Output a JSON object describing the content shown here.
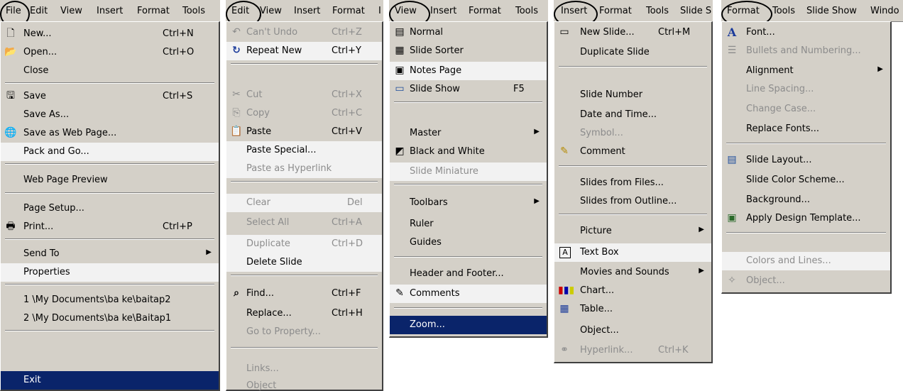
{
  "file_panel": {
    "menubar": [
      "File",
      "Edit",
      "View",
      "Insert",
      "Format",
      "Tools"
    ],
    "rows": [
      {
        "icon": "new-document-icon",
        "label": "New...",
        "shortcut": "Ctrl+N"
      },
      {
        "icon": "open-folder-icon",
        "label": "Open...",
        "shortcut": "Ctrl+O"
      },
      {
        "label": "Close"
      },
      {
        "icon": "save-disk-icon",
        "label": "Save",
        "shortcut": "Ctrl+S"
      },
      {
        "label": "Save As..."
      },
      {
        "icon": "save-web-page-icon",
        "label": "Save as Web Page..."
      },
      {
        "label": "Pack and Go..."
      },
      {
        "label": "Web Page Preview"
      },
      {
        "label": "Page Setup..."
      },
      {
        "icon": "printer-icon",
        "label": "Print...",
        "shortcut": "Ctrl+P"
      },
      {
        "label": "Send To",
        "submenu": true
      },
      {
        "label": "Properties"
      },
      {
        "label": "1 \\My Documents\\ba ke\\baitap2"
      },
      {
        "label": "2 \\My Documents\\ba ke\\Baitap1"
      },
      {
        "label": "Exit"
      }
    ]
  },
  "edit_panel": {
    "menubar": [
      "Edit",
      "View",
      "Insert",
      "Format",
      "I"
    ],
    "rows": [
      {
        "icon": "undo-icon",
        "label": "Can't Undo",
        "shortcut": "Ctrl+Z",
        "disabled": true
      },
      {
        "icon": "repeat-icon",
        "label": "Repeat New",
        "shortcut": "Ctrl+Y"
      },
      {
        "icon": "cut-scissors-icon",
        "label": "Cut",
        "shortcut": "Ctrl+X",
        "disabled": true
      },
      {
        "icon": "copy-icon",
        "label": "Copy",
        "shortcut": "Ctrl+C",
        "disabled": true
      },
      {
        "icon": "paste-clipboard-icon",
        "label": "Paste",
        "shortcut": "Ctrl+V"
      },
      {
        "label": "Paste Special..."
      },
      {
        "label": "Paste as Hyperlink",
        "disabled": true
      },
      {
        "label": "Clear",
        "shortcut": "Del",
        "disabled": true
      },
      {
        "label": "Select All",
        "shortcut": "Ctrl+A",
        "disabled": true
      },
      {
        "label": "Duplicate",
        "shortcut": "Ctrl+D",
        "disabled": true
      },
      {
        "label": "Delete Slide"
      },
      {
        "icon": "binoculars-icon",
        "label": "Find...",
        "shortcut": "Ctrl+F"
      },
      {
        "label": "Replace...",
        "shortcut": "Ctrl+H"
      },
      {
        "label": "Go to Property...",
        "disabled": true
      },
      {
        "label": "Links...",
        "disabled": true
      },
      {
        "label": "Object",
        "disabled": true
      }
    ]
  },
  "view_panel": {
    "menubar": [
      "View",
      "Insert",
      "Format",
      "Tools"
    ],
    "rows": [
      {
        "icon": "normal-view-icon",
        "label": "Normal"
      },
      {
        "icon": "slide-sorter-icon",
        "label": "Slide Sorter"
      },
      {
        "icon": "notes-page-icon",
        "label": "Notes Page"
      },
      {
        "icon": "slide-show-icon",
        "label": "Slide Show",
        "shortcut": "F5"
      },
      {
        "label": "Master",
        "submenu": true
      },
      {
        "icon": "black-white-icon",
        "label": "Black and White"
      },
      {
        "label": "Slide Miniature",
        "disabled": true
      },
      {
        "label": "Toolbars",
        "submenu": true
      },
      {
        "label": "Ruler"
      },
      {
        "label": "Guides"
      },
      {
        "label": "Header and Footer..."
      },
      {
        "icon": "comments-icon",
        "label": "Comments"
      },
      {
        "label": "Zoom..."
      }
    ]
  },
  "insert_panel": {
    "menubar": [
      "Insert",
      "Format",
      "Tools",
      "Slide S"
    ],
    "rows": [
      {
        "icon": "new-slide-icon",
        "label": "New Slide...",
        "shortcut": "Ctrl+M"
      },
      {
        "label": "Duplicate Slide"
      },
      {
        "label": "Slide Number"
      },
      {
        "label": "Date and Time..."
      },
      {
        "label": "Symbol...",
        "disabled": true
      },
      {
        "icon": "comment-icon",
        "label": "Comment"
      },
      {
        "label": "Slides from Files..."
      },
      {
        "label": "Slides from Outline..."
      },
      {
        "label": "Picture",
        "submenu": true
      },
      {
        "icon": "text-box-icon",
        "label": "Text Box"
      },
      {
        "label": "Movies and Sounds",
        "submenu": true
      },
      {
        "icon": "chart-icon",
        "label": "Chart..."
      },
      {
        "icon": "table-icon",
        "label": "Table..."
      },
      {
        "label": "Object..."
      },
      {
        "icon": "hyperlink-icon",
        "label": "Hyperlink...",
        "shortcut": "Ctrl+K",
        "disabled": true
      }
    ]
  },
  "format_panel": {
    "menubar": [
      "Format",
      "Tools",
      "Slide Show",
      "Windo"
    ],
    "rows": [
      {
        "icon": "font-icon",
        "label": "Font..."
      },
      {
        "icon": "bullets-icon",
        "label": "Bullets and Numbering...",
        "disabled": true
      },
      {
        "label": "Alignment",
        "submenu": true
      },
      {
        "label": "Line Spacing...",
        "disabled": true
      },
      {
        "label": "Change Case...",
        "disabled": true
      },
      {
        "label": "Replace Fonts..."
      },
      {
        "icon": "slide-layout-icon",
        "label": "Slide Layout..."
      },
      {
        "label": "Slide Color Scheme..."
      },
      {
        "label": "Background..."
      },
      {
        "icon": "design-template-icon",
        "label": "Apply Design Template..."
      },
      {
        "label": "Colors and Lines...",
        "disabled": true
      },
      {
        "icon": "object-icon",
        "label": "Object...",
        "disabled": true
      }
    ]
  },
  "icon_glyphs": {
    "new-document-icon": "🗋",
    "open-folder-icon": "📂",
    "save-disk-icon": "🖫",
    "save-web-page-icon": "🌐",
    "printer-icon": "🖶",
    "undo-icon": "↶",
    "repeat-icon": "↻",
    "cut-scissors-icon": "✂",
    "copy-icon": "⎘",
    "paste-clipboard-icon": "📋",
    "binoculars-icon": "⌕",
    "normal-view-icon": "▤",
    "slide-sorter-icon": "▦",
    "notes-page-icon": "▣",
    "slide-show-icon": "▭",
    "black-white-icon": "◩",
    "comments-icon": "✎",
    "new-slide-icon": "▭",
    "comment-icon": "✎",
    "text-box-icon": "A",
    "chart-icon": "▮",
    "table-icon": "▦",
    "hyperlink-icon": "⚭",
    "font-icon": "A",
    "bullets-icon": "☰",
    "slide-layout-icon": "▤",
    "design-template-icon": "▣",
    "object-icon": "✧"
  }
}
